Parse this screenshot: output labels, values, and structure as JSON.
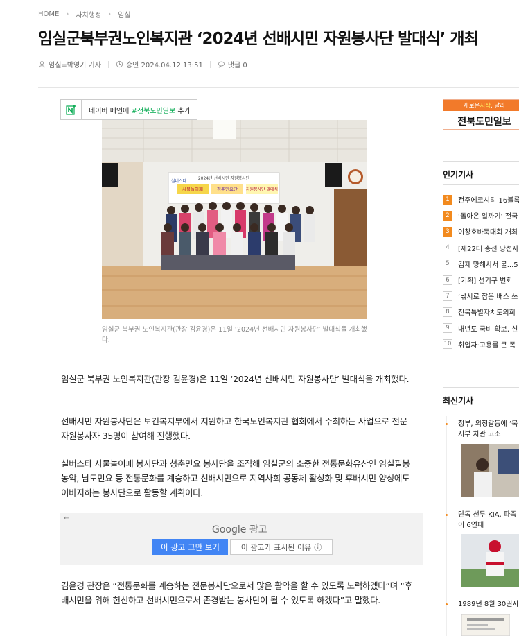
{
  "breadcrumb": {
    "home": "HOME",
    "section": "자치행정",
    "subsection": "임실"
  },
  "article": {
    "title": "임실군북부권노인복지관 ‘2024년 선배시민 자원봉사단 발대식’ 개최",
    "author": "임실=박영기 기자",
    "approved": "승인 2024.04.12 13:51",
    "comments": "댓글 0",
    "photo_caption": "임실군 북부권 노인복지관(관장 김윤경)은 11일 ‘2024년 선배시민 자원봉사단’ 발대식을 개최했다.",
    "paragraphs": [
      "임실군 북부권 노인복지관(관장 김윤경)은 11일 ‘2024년 선배시민 자원봉사단’ 발대식을 개최했다.",
      "선배시민 자원봉사단은 보건복지부에서 지원하고 한국노인복지관 협회에서 주최하는 사업으로 전문자원봉사자 35명이 참여해 진행했다.",
      "실버스타 사물놀이패 봉사단과 청춘민요 봉사단을 조직해 임실군의 소중한 전통문화유산인 임실필봉농악, 남도민요 등 전통문화를 계승하고 선배시민으로 지역사회 공동체 활성화 및 후배시민 양성에도 이바지하는 봉사단으로 활동할 계획이다.",
      "김윤경 관장은 “전통문화를 계승하는 전문봉사단으로서 많은 활약을 할 수 있도록 노력하겠다”며 “후배시민을 위해 헌신하고 선배시민으로서 존경받는 봉사단이 될 수 있도록 하겠다”고 말했다."
    ]
  },
  "photo_banner": {
    "line1": "2024년 선배시민 자원봉사단",
    "left": "사물놀이패",
    "mid": "청춘민요단",
    "right": "자원봉사단 발대식",
    "logo": "실버스타"
  },
  "naver": {
    "prefix": "네이버 메인에 ",
    "brand": "#전북도민일보",
    "suffix": " 추가"
  },
  "ad": {
    "back": "←",
    "google": "Google",
    "google_suffix": " 광고",
    "stop": "이 광고 그만 보기",
    "why": "이 광고가 표시된 이유",
    "info_icon": "ⓘ"
  },
  "sidebar": {
    "banner_top_a": "새로운 ",
    "banner_top_b": "시작",
    "banner_top_c": ", 달라",
    "banner_bottom": "전북도민일보",
    "popular_title": "인기기사",
    "popular": [
      {
        "num": "1",
        "title": "전주에코시티 16블록"
      },
      {
        "num": "2",
        "title": "‘돌아온 알까기’ 전국"
      },
      {
        "num": "3",
        "title": "이창호바둑대회 개최"
      },
      {
        "num": "4",
        "title": "[제22대 총선 당선자"
      },
      {
        "num": "5",
        "title": "김제 망해사서 불...5"
      },
      {
        "num": "6",
        "title": "[기획] 선거구 변화"
      },
      {
        "num": "7",
        "title": "‘낚시로 잡은 배스 쓰"
      },
      {
        "num": "8",
        "title": "전북특별자치도의회"
      },
      {
        "num": "9",
        "title": "내년도 국비 확보, 신"
      },
      {
        "num": "10",
        "title": "취업자·고용률 큰 폭"
      }
    ],
    "latest_title": "최신기사",
    "latest": [
      {
        "title": "정부, 의정갈등에 ‘묵 복지부 차관 고소"
      },
      {
        "title": "단독 선두 KIA, 파죽 없이 6연패"
      },
      {
        "title": "1989년 8월 30일자 1"
      }
    ]
  },
  "colors": {
    "accent": "#f28a1e",
    "naver_green": "#03a94f",
    "google_blue": "#4285f4"
  }
}
